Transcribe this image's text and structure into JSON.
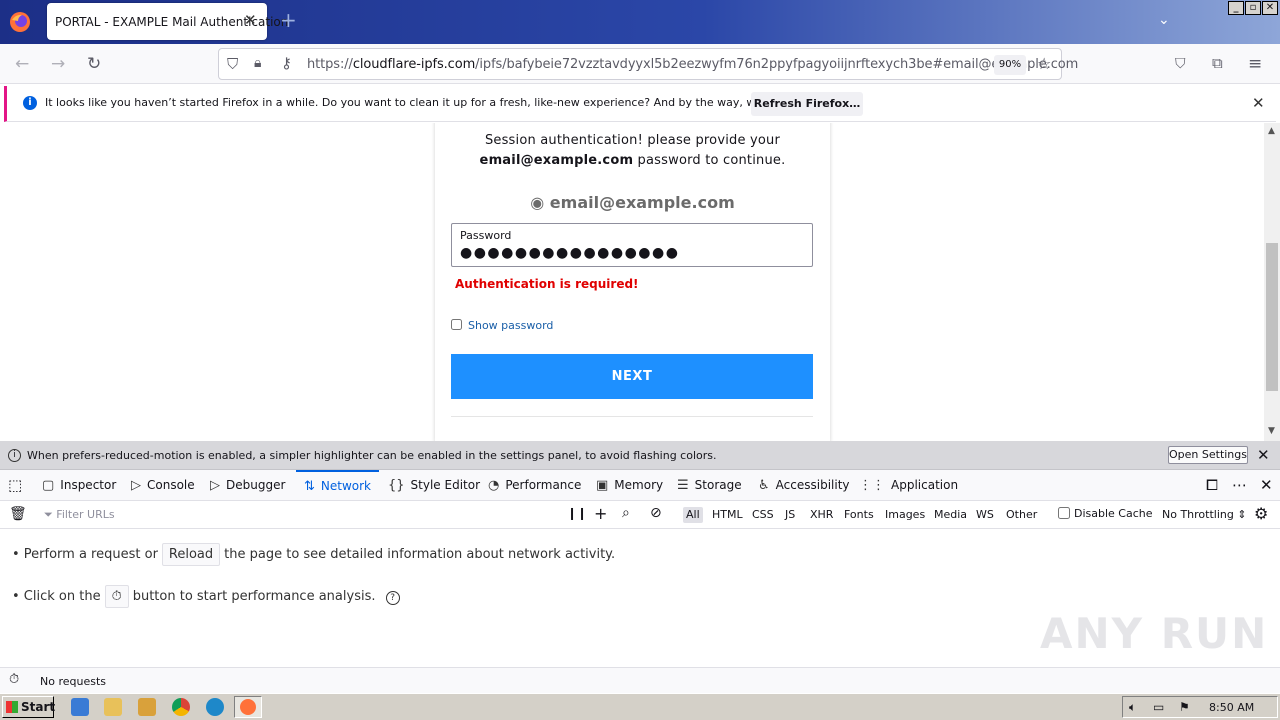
{
  "browser": {
    "tab_title": "PORTAL - EXAMPLE Mail Authentication",
    "tab_close": "✕",
    "new_tab": "+",
    "url_prefix": "https://",
    "url_domain": "cloudflare-ipfs.com",
    "url_path": "/ipfs/bafybeie72vzztavdyyxl5b2eezwyfm76n2ppyfpagyoiijnrftexych3be#email@example.com",
    "zoom": "90%",
    "notification": "It looks like you haven’t started Firefox in a while. Do you want to clean it up for a fresh, like-new experience? And by the way, welcome back!",
    "refresh_label": "Refresh Firefox…"
  },
  "login": {
    "prompt_line1": "Session authentication! please provide your",
    "prompt_email": "email@example.com",
    "prompt_line2_rest": " password to continue.",
    "user_email": "email@example.com",
    "password_label": "Password",
    "password_mask": "●●●●●●●●●●●●●●●●",
    "error": "Authentication is required!",
    "show_password": "Show password",
    "next_label": "NEXT"
  },
  "devtools": {
    "warning": "When prefers-reduced-motion is enabled, a simpler highlighter can be enabled in the settings panel, to avoid flashing colors.",
    "open_settings": "Open Settings",
    "tabs": [
      "Inspector",
      "Console",
      "Debugger",
      "Network",
      "Style Editor",
      "Performance",
      "Memory",
      "Storage",
      "Accessibility",
      "Application"
    ],
    "selected_tab": "Network",
    "filter_placeholder": "Filter URLs",
    "filter_types": [
      "All",
      "HTML",
      "CSS",
      "JS",
      "XHR",
      "Fonts",
      "Images",
      "Media",
      "WS",
      "Other"
    ],
    "disable_cache": "Disable Cache",
    "throttling": "No Throttling ⇕",
    "line1_pre": "• Perform a request or",
    "reload_btn": "Reload",
    "line1_post": "the page to see detailed information about network activity.",
    "line2_pre": "• Click on the",
    "line2_post": "button to start performance analysis.",
    "status": "No requests"
  },
  "taskbar": {
    "start": "Start",
    "clock": "8:50 AM"
  },
  "watermark": "ANY RUN"
}
